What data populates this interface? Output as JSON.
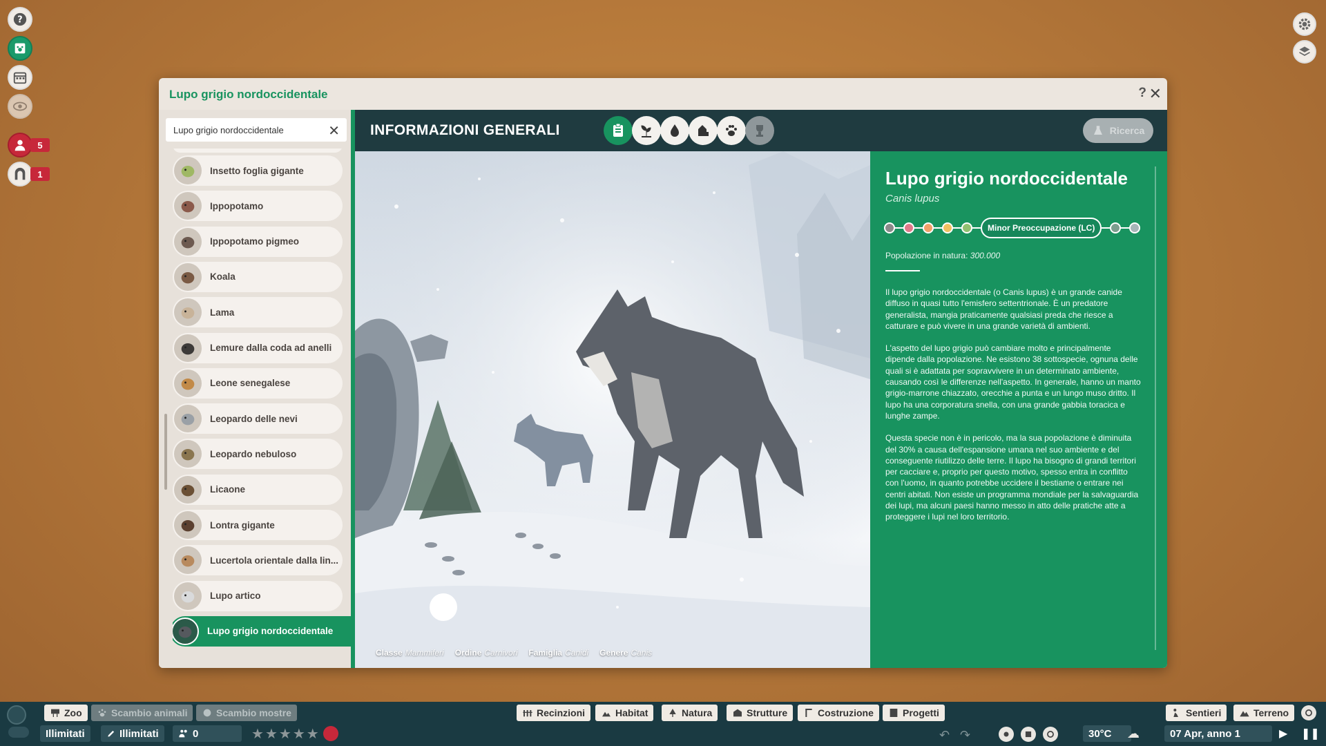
{
  "window": {
    "title": "Lupo grigio nordoccidentale",
    "help": "?",
    "close": "✕"
  },
  "left_bar": {
    "badges": {
      "staff": "5",
      "guests": "1"
    }
  },
  "search": {
    "value": "Lupo grigio nordoccidentale",
    "clear": "✕"
  },
  "animal_list": [
    {
      "label": "Insetto foglia gigante",
      "icon": "leaf-insect-icon"
    },
    {
      "label": "Ippopotamo",
      "icon": "hippo-icon"
    },
    {
      "label": "Ippopotamo pigmeo",
      "icon": "pygmy-hippo-icon"
    },
    {
      "label": "Koala",
      "icon": "koala-icon"
    },
    {
      "label": "Lama",
      "icon": "llama-icon"
    },
    {
      "label": "Lemure dalla coda ad anelli",
      "icon": "lemur-icon"
    },
    {
      "label": "Leone senegalese",
      "icon": "lion-icon"
    },
    {
      "label": "Leopardo delle nevi",
      "icon": "snow-leopard-icon"
    },
    {
      "label": "Leopardo nebuloso",
      "icon": "clouded-leopard-icon"
    },
    {
      "label": "Licaone",
      "icon": "wild-dog-icon"
    },
    {
      "label": "Lontra gigante",
      "icon": "otter-icon"
    },
    {
      "label": "Lucertola orientale dalla lin...",
      "icon": "lizard-icon"
    },
    {
      "label": "Lupo artico",
      "icon": "arctic-wolf-icon"
    },
    {
      "label": "Lupo grigio nordoccidentale",
      "icon": "grey-wolf-icon",
      "active": true
    }
  ],
  "header": {
    "title": "INFORMAZIONI GENERALI",
    "research_label": "Ricerca"
  },
  "taxonomy": {
    "class_label": "Classe",
    "class_value": "Mammiferi",
    "order_label": "Ordine",
    "order_value": "Carnivori",
    "family_label": "Famiglia",
    "family_value": "Canidi",
    "genus_label": "Genere",
    "genus_value": "Canis"
  },
  "info": {
    "name": "Lupo grigio nordoccidentale",
    "scientific": "Canis lupus",
    "status": "Minor Preoccupazione (LC)",
    "status_colors": [
      "#8a8a8a",
      "#e07a8a",
      "#f2a068",
      "#f0c060",
      "#90c070"
    ],
    "population_label": "Popolazione in natura:",
    "population_value": "300.000",
    "paragraphs": [
      "Il lupo grigio nordoccidentale (o Canis lupus) è un grande canide diffuso in quasi tutto l'emisfero settentrionale. È un predatore generalista, mangia praticamente qualsiasi preda che riesce a catturare e può vivere in una grande varietà di ambienti.",
      "L'aspetto del lupo grigio può cambiare molto e principalmente dipende dalla popolazione. Ne esistono 38 sottospecie, ognuna delle quali si è adattata per sopravvivere in un determinato ambiente, causando così le differenze nell'aspetto. In generale, hanno un manto grigio-marrone chiazzato, orecchie a punta e un lungo muso dritto. Il lupo ha una corporatura snella, con una grande gabbia toracica e lunghe zampe.",
      "Questa specie non è in pericolo, ma la sua popolazione è diminuita del 30% a causa dell'espansione umana nel suo ambiente e del conseguente riutilizzo delle terre. Il lupo ha bisogno di grandi territori per cacciare e, proprio per questo motivo, spesso entra in conflitto con l'uomo, in quanto potrebbe uccidere il bestiame o entrare nei centri abitati. Non esiste un programma mondiale per la salvaguardia dei lupi, ma alcuni paesi hanno messo in atto delle pratiche atte a proteggere i lupi nel loro territorio."
    ]
  },
  "bottom": {
    "zoo": "Zoo",
    "animal_trade": "Scambio animali",
    "exhibit_trade": "Scambio mostre",
    "fences": "Recinzioni",
    "habitat": "Habitat",
    "nature": "Natura",
    "structures": "Strutture",
    "construction": "Costruzione",
    "projects": "Progetti",
    "paths": "Sentieri",
    "terrain": "Terreno",
    "money": "Illimitati",
    "research_points": "Illimitati",
    "guests": "0",
    "temperature": "30°C",
    "date": "07 Apr, anno 1"
  }
}
